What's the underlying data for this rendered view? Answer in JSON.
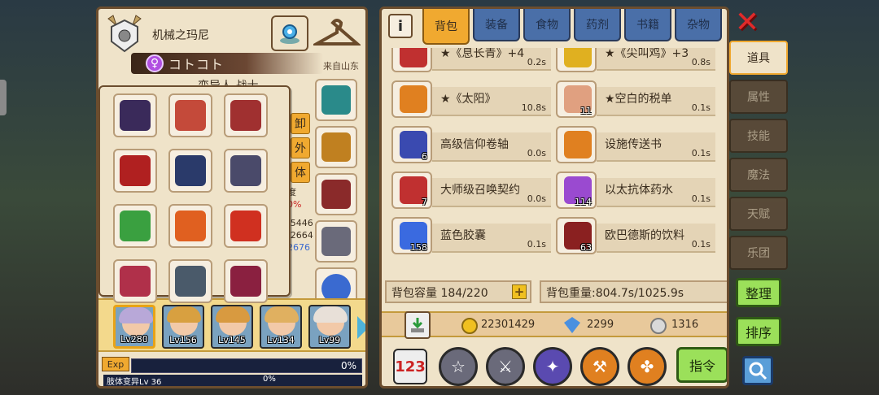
{
  "character": {
    "name": "机械之玛尼",
    "title": "コトコト",
    "origin": "来自山东",
    "race_class": "变异人 战士",
    "stat_fragments": [
      "度",
      "0%",
      "/5446",
      "/2664",
      "2676"
    ]
  },
  "side_buttons": {
    "unequip_peek": "卸",
    "outer_peek": "外",
    "outer_peek2": "体"
  },
  "equipment_slots": [
    {
      "icon": "helmet-icon",
      "color": "#3a2a5a"
    },
    {
      "icon": "necklace-icon",
      "color": "#c44a3a"
    },
    {
      "icon": "gauntlet-icon",
      "color": "#a03030"
    },
    {
      "icon": "cape-icon",
      "color": "#b02020"
    },
    {
      "icon": "armor-icon",
      "color": "#2a3a6a"
    },
    {
      "icon": "shield-icon",
      "color": "#4a4a6a"
    },
    {
      "icon": "spear-icon",
      "color": "#3aa040"
    },
    {
      "icon": "staff-icon",
      "color": "#e06020"
    },
    {
      "icon": "wand-icon",
      "color": "#d03020"
    },
    {
      "icon": "axe-icon",
      "color": "#b0304a"
    },
    {
      "icon": "beast-icon",
      "color": "#4a5a6a"
    },
    {
      "icon": "blade-icon",
      "color": "#8a2040"
    }
  ],
  "right_slots": [
    {
      "icon": "crystal-icon",
      "color": "#2a8a8a"
    },
    {
      "icon": "crown-icon",
      "color": "#c08020"
    },
    {
      "icon": "chest-icon",
      "color": "#8a2a2a"
    },
    {
      "icon": "gear-icon",
      "color": "#6a6a7a"
    },
    {
      "icon": "ring-icon",
      "color": "#3a6ad0"
    }
  ],
  "party": [
    {
      "level": "Lv280",
      "hair": "#b8a8d8"
    },
    {
      "level": "Lv156",
      "hair": "#d8a040"
    },
    {
      "level": "Lv145",
      "hair": "#d89a40"
    },
    {
      "level": "Lv134",
      "hair": "#e0b060"
    },
    {
      "level": "Lv99",
      "hair": "#e8e0d8"
    }
  ],
  "exp": {
    "tag": "Exp",
    "percent": "0%",
    "sub_label": "肢体变异Lv 36",
    "sub_percent": "0%"
  },
  "tabs": [
    "背包",
    "装备",
    "食物",
    "药剂",
    "书籍",
    "杂物"
  ],
  "items": [
    {
      "name": "★《息长青》+4",
      "count": "",
      "weight": "0.2s",
      "color": "#c03030"
    },
    {
      "name": "★《尖叫鸡》+3",
      "count": "",
      "weight": "0.8s",
      "color": "#e0b020"
    },
    {
      "name": "★《太阳》",
      "count": "",
      "weight": "10.8s",
      "color": "#e08020"
    },
    {
      "name": "★空白的税单",
      "count": "11",
      "weight": "0.1s",
      "color": "#e0a080"
    },
    {
      "name": "高级信仰卷轴",
      "count": "6",
      "weight": "0.0s",
      "color": "#3a4ab0"
    },
    {
      "name": "设施传送书",
      "count": "",
      "weight": "0.1s",
      "color": "#e08020"
    },
    {
      "name": "大师级召唤契约",
      "count": "7",
      "weight": "0.0s",
      "color": "#c03030"
    },
    {
      "name": "以太抗体药水",
      "count": "114",
      "weight": "0.1s",
      "color": "#9a4ad0"
    },
    {
      "name": "蓝色胶囊",
      "count": "158",
      "weight": "0.1s",
      "color": "#3a6ae0"
    },
    {
      "name": "欧巴德斯的饮料",
      "count": "63",
      "weight": "0.1s",
      "color": "#8a2020"
    }
  ],
  "inventory": {
    "capacity_label": "背包容量 184/220",
    "capacity_plus": "+",
    "weight_label": "背包重量:804.7s/1025.9s"
  },
  "currencies": {
    "gold": "22301429",
    "gems": "2299",
    "silver": "1316"
  },
  "actions": {
    "numbering": "123",
    "command": "指令"
  },
  "side_tabs": [
    "道具",
    "属性",
    "技能",
    "魔法",
    "天赋",
    "乐团"
  ],
  "side_actions": {
    "sort": "整理",
    "order": "排序"
  },
  "close_label": "✕"
}
